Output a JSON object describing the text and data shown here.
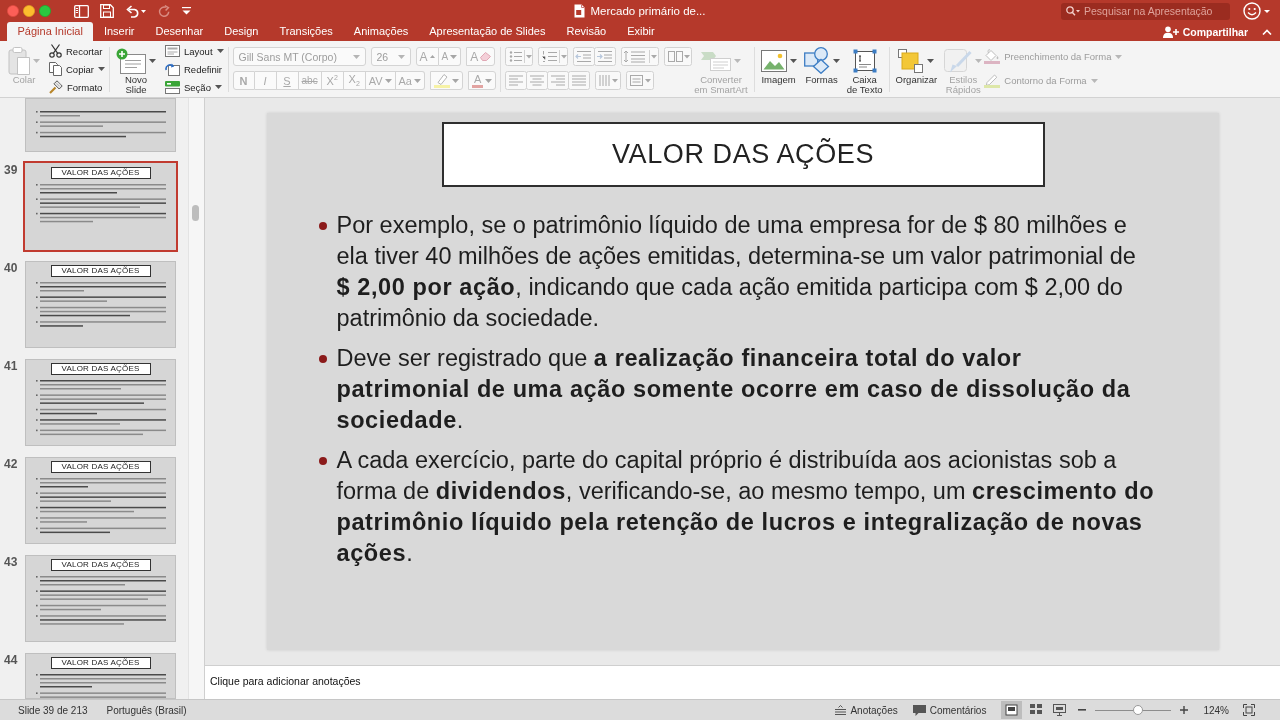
{
  "window": {
    "title": "Mercado primário de...",
    "toolbar": [
      {
        "kind": "sidebar",
        "disabled": false
      },
      {
        "kind": "save",
        "disabled": false
      },
      {
        "kind": "undo",
        "disabled": false
      },
      {
        "kind": "redo",
        "disabled": true
      },
      {
        "kind": "customize",
        "disabled": false
      }
    ],
    "search": {
      "placeholder": "Pesquisar na Apresentação"
    }
  },
  "tabs": [
    {
      "label": "Página Inicial",
      "selected": true
    },
    {
      "label": "Inserir",
      "selected": false
    },
    {
      "label": "Desenhar",
      "selected": false
    },
    {
      "label": "Design",
      "selected": false
    },
    {
      "label": "Transições",
      "selected": false
    },
    {
      "label": "Animações",
      "selected": false
    },
    {
      "label": "Apresentação de Slides",
      "selected": false
    },
    {
      "label": "Revisão",
      "selected": false
    },
    {
      "label": "Exibir",
      "selected": false
    }
  ],
  "share": {
    "label": "Compartilhar"
  },
  "ribbon": {
    "paste": {
      "label": "Colar",
      "disabled": true
    },
    "clipboard": [
      {
        "kind": "cut",
        "label": "Recortar"
      },
      {
        "kind": "copy",
        "label": "Copiar"
      },
      {
        "kind": "format",
        "label": "Formato"
      }
    ],
    "new_slide": {
      "label": "Novo Slide"
    },
    "slide_actions": [
      {
        "kind": "layout",
        "label": "Layout"
      },
      {
        "kind": "reset",
        "label": "Redefinir"
      },
      {
        "kind": "section",
        "label": "Seção"
      }
    ],
    "font": {
      "disabled": true,
      "family": "Gill Sans MT (Corpo)",
      "size": "26",
      "grow": "A",
      "shrink": "A",
      "clear": "A",
      "styles": [
        {
          "kind": "bold",
          "label": "N"
        },
        {
          "kind": "italic",
          "label": "I"
        },
        {
          "kind": "underline",
          "label": "S"
        },
        {
          "kind": "strike",
          "label": "abc"
        },
        {
          "kind": "superscript",
          "label": "X$^{2}$"
        },
        {
          "kind": "subscript",
          "label": "X$_{2}$"
        },
        {
          "kind": "spacing",
          "label": "AV"
        },
        {
          "kind": "case",
          "label": "Aa"
        }
      ],
      "font_color": "A"
    },
    "paragraph": {
      "disabled": true
    },
    "smartart": {
      "label": "Converter em SmartArt",
      "disabled": true
    },
    "insert": [
      {
        "kind": "image",
        "label": "Imagem"
      },
      {
        "kind": "shapes",
        "label": "Formas"
      },
      {
        "kind": "textbox",
        "label": "Caixa de Texto"
      }
    ],
    "arrange": {
      "label": "Organizar"
    },
    "quick_styles": {
      "label": "Estilos Rápidos",
      "disabled": true
    },
    "shape_format": [
      {
        "kind": "fill",
        "label": "Preenchimento da Forma",
        "disabled": true
      },
      {
        "kind": "outline",
        "label": "Contorno da Forma",
        "disabled": true
      }
    ]
  },
  "slides_panel": {
    "thumbnails": [
      {
        "selected": false
      },
      {
        "number": "39",
        "title": "VALOR DAS AÇÕES",
        "selected": true
      },
      {
        "number": "40",
        "title": "VALOR DAS AÇÕES",
        "selected": false
      },
      {
        "number": "41",
        "title": "VALOR DAS AÇÕES",
        "selected": false
      },
      {
        "number": "42",
        "title": "VALOR DAS AÇÕES",
        "selected": false
      },
      {
        "number": "43",
        "title": "VALOR DAS AÇÕES",
        "selected": false
      },
      {
        "number": "44",
        "title": "VALOR DAS AÇÕES",
        "selected": false
      }
    ]
  },
  "slide": {
    "title": "VALOR DAS AÇÕES",
    "bullets": [
      "Por exemplo, se o patrimônio líquido de uma empresa for de $ 80 milhões e ela tiver 40 milhões de ações emitidas, determina-se um valor patrimonial de **$ 2,00 por ação**, indicando que cada ação emitida participa com $ 2,00 do patrimônio da sociedade.",
      "Deve ser registrado que **a realização financeira total do valor patrimonial de uma ação somente ocorre em caso de dissolução da sociedade**.",
      "A cada exercício, parte do capital próprio é distribuída aos acionistas sob a forma de **dividendos**, verificando-se, ao mesmo tempo, um **crescimento do patrimônio líquido pela retenção de lucros e integralização de novas ações**."
    ]
  },
  "notes": {
    "placeholder": "Clique para adicionar anotações"
  },
  "status_bar": {
    "slide_info": "Slide 39 de 213",
    "language": "Português (Brasil)",
    "notes": "Anotações",
    "comments": "Comentários",
    "views": [
      {
        "kind": "normal",
        "selected": true
      },
      {
        "kind": "sorter",
        "selected": false
      },
      {
        "kind": "presenter",
        "selected": false
      }
    ],
    "zoom": {
      "level": 0.56,
      "label": "124%"
    }
  }
}
